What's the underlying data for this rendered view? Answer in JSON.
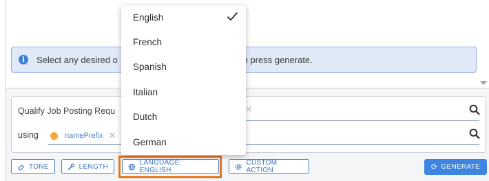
{
  "info_banner": {
    "text_left": "Select any desired o",
    "text_right": "s, then press generate.",
    "icon": "info-icon"
  },
  "prompt": {
    "line1_text": "Qualify Job Posting Requ",
    "using_label": "using",
    "token_label": "namePrefix",
    "token_dot_color": "#f4a53b"
  },
  "toolbar": {
    "tone_label": "TONE",
    "length_label": "LENGTH",
    "language_label": "LANGUAGE: ENGLISH",
    "custom_action_label": "CUSTOM ACTION",
    "generate_label": "GENERATE"
  },
  "language_menu": {
    "selected": "English",
    "items": [
      "English",
      "French",
      "Spanish",
      "Italian",
      "Dutch",
      "German"
    ]
  },
  "colors": {
    "accent": "#3d85e0",
    "highlight": "#e8731d",
    "banner_bg": "#dfe9f8"
  }
}
